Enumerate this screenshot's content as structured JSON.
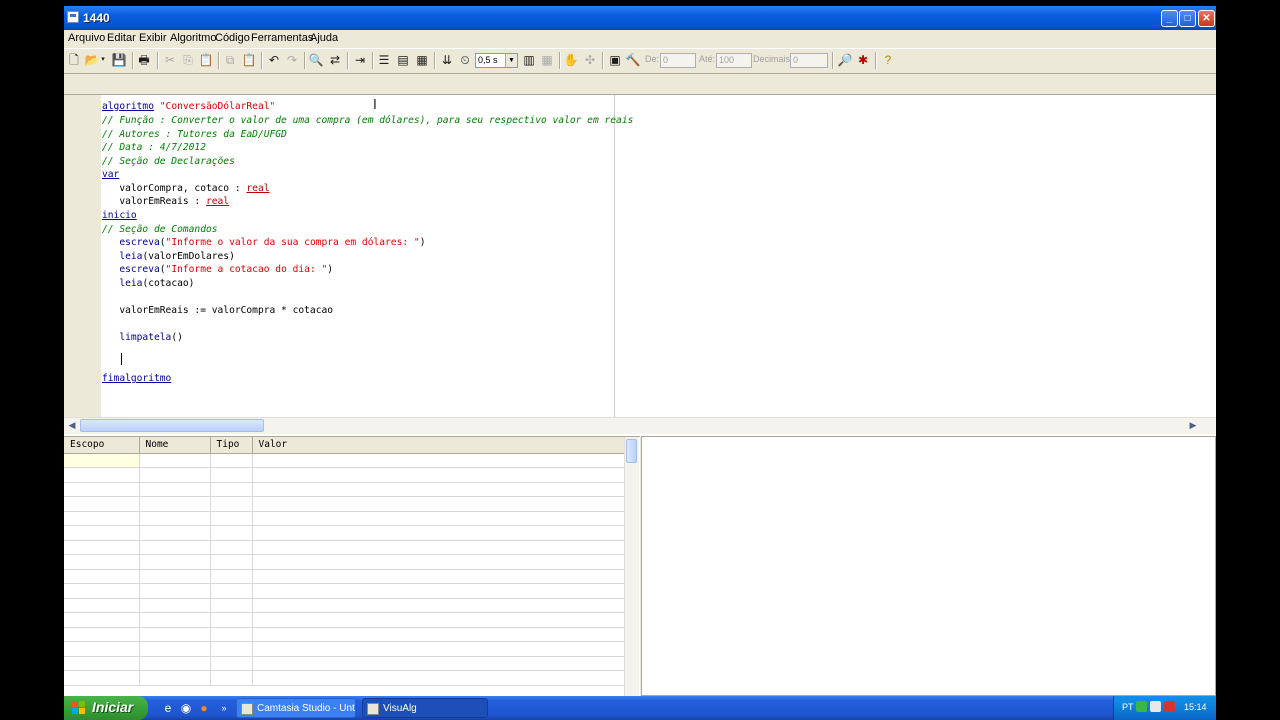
{
  "window": {
    "title": "1440",
    "controls": {
      "minimize": "_",
      "maximize": "□",
      "close": "✕"
    }
  },
  "menu": [
    "Arquivo",
    "Editar",
    "Exibir",
    "Algoritmo",
    "Código",
    "Ferramentas",
    "Ajuda"
  ],
  "toolbar": {
    "speed_value": "0,5 s",
    "de_label": "De:",
    "de_value": "0",
    "ate_label": "Até:",
    "ate_value": "100",
    "decimais_label": "Decimais:",
    "decimais_value": "0"
  },
  "code": {
    "algoritmo_kw": "algoritmo",
    "algoritmo_name": "\"ConversãoDólarReal\"",
    "comment_funcao": "// Função : Converter o valor de uma compra (em dólares), para seu respectivo valor em reais",
    "comment_autores": "// Autores : Tutores da EaD/UFGD",
    "comment_data": "// Data : 4/7/2012",
    "comment_declaracoes": "// Seção de Declarações",
    "var_kw": "var",
    "decl1_vars": "   valorCompra, cotaco : ",
    "decl2_vars": "   valorEmReais : ",
    "type_real": "real",
    "inicio_kw": "inicio",
    "comment_comandos": "// Seção de Comandos",
    "escreva_kw": "escreva",
    "leia_kw": "leia",
    "escreva1_str": "\"Informe o valor da sua compra em dólares: \"",
    "leia1_arg": "valorEmDolares",
    "escreva2_str": "\"Informe a cotacao do dia: \"",
    "leia2_arg": "cotacao",
    "assign_line": "   valorEmReais := valorCompra * cotacao",
    "limpatela": "limpatela",
    "fimalgoritmo_kw": "fimalgoritmo"
  },
  "variables_table": {
    "columns": [
      "Escopo",
      "Nome",
      "Tipo",
      "Valor"
    ],
    "rows": []
  },
  "taskbar": {
    "start_label": "Iniciar",
    "tasks": [
      "Camtasia Studio - Unt...",
      "VisuAlg"
    ],
    "tray_lang": "PT",
    "clock": "15:14"
  },
  "colors": {
    "keyword": "#0000a0",
    "string": "#e00000",
    "comment": "#008000",
    "type": "#c00000"
  }
}
